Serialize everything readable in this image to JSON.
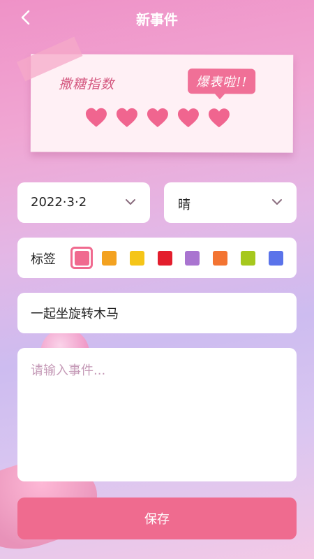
{
  "header": {
    "title": "新事件",
    "back_icon": "chevron-left-icon"
  },
  "sweetness": {
    "label": "撒糖指数",
    "bubble": "爆表啦!!",
    "level": 5,
    "max": 5,
    "heart_color": "#f0658f"
  },
  "date": {
    "value": "2022·3·2",
    "icon": "chevron-down-icon"
  },
  "weather": {
    "value": "晴",
    "icon": "chevron-down-icon"
  },
  "tags": {
    "label": "标签",
    "selected_index": 0,
    "colors": [
      "#f06a8f",
      "#f3a220",
      "#f5c518",
      "#e31e2d",
      "#a974d0",
      "#f37432",
      "#a6c81d",
      "#5a73ea"
    ]
  },
  "event_title": {
    "value": "一起坐旋转木马"
  },
  "event_desc": {
    "value": "",
    "placeholder": "请输入事件..."
  },
  "save": {
    "label": "保存"
  },
  "colors": {
    "accent": "#ef6b8f",
    "card": "#ffffff"
  }
}
